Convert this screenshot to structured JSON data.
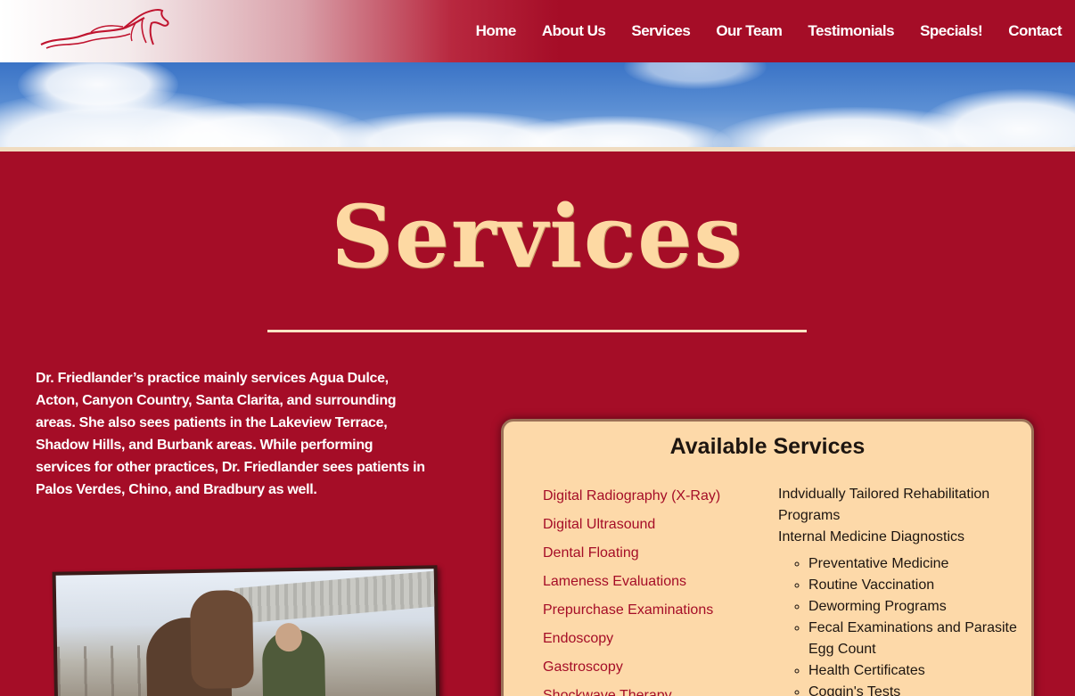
{
  "header": {
    "logo_name": "horse-logo",
    "nav": [
      "Home",
      "About Us",
      "Services",
      "Our Team",
      "Testimonials",
      "Specials!",
      "Contact"
    ]
  },
  "page": {
    "title": "Services",
    "intro": "Dr. Friedlander’s practice mainly services Agua Dulce, Acton, Canyon Country, Santa Clarita, and surrounding areas. She also sees patients in the Lakeview Terrace, Shadow Hills, and Burbank areas. While performing services for other practices, Dr. Friedlander sees patients in Palos Verdes, Chino, and Bradbury as well."
  },
  "services": {
    "title": "Available Services",
    "left": [
      "Digital Radiography (X-Ray)",
      "Digital Ultrasound",
      "Dental Floating",
      "Lameness Evaluations",
      "Prepurchase Examinations",
      "Endoscopy",
      "Gastroscopy",
      "Shockwave Therapy"
    ],
    "right_lines": [
      "Indvidually Tailored Rehabilitation Programs",
      "Internal Medicine Diagnostics"
    ],
    "right_sub": [
      "Preventative Medicine",
      "Routine Vaccination",
      "Deworming Programs",
      "Fecal Examinations and Parasite Egg Count",
      "Health Certificates",
      "Coggin's Tests"
    ]
  },
  "colors": {
    "primary": "#a50d27",
    "title": "#fdd9a3",
    "box": "#fdd9a9"
  }
}
